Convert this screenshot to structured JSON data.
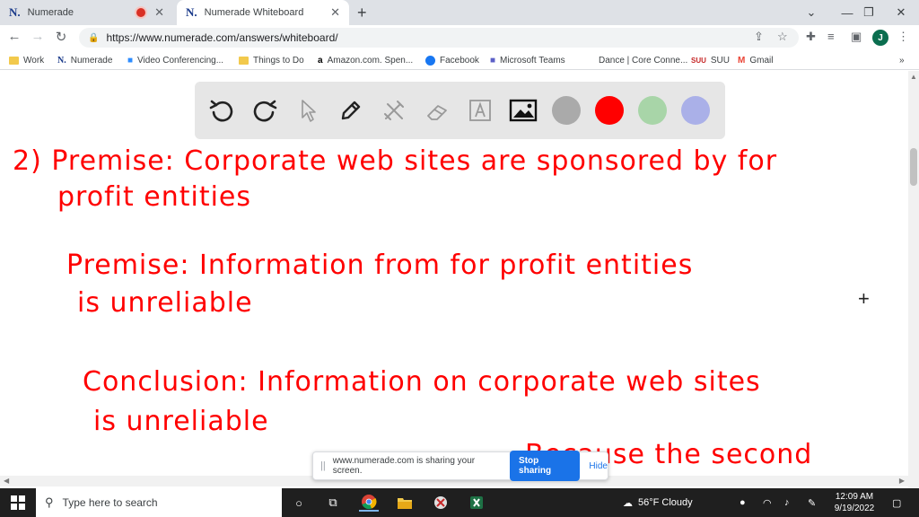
{
  "browser": {
    "tabs": [
      {
        "label": "Numerade",
        "favicon": "N."
      },
      {
        "label": "Numerade Whiteboard",
        "favicon": "N."
      }
    ],
    "new_tab": "+",
    "address": "https://www.numerade.com/answers/whiteboard/",
    "profile_initial": "J",
    "bookmarks": [
      {
        "label": "Work",
        "icon": "folder-icon"
      },
      {
        "label": "Numerade",
        "icon": "N."
      },
      {
        "label": "Video Conferencing...",
        "icon": "video-icon"
      },
      {
        "label": "Things to Do",
        "icon": "folder-icon"
      },
      {
        "label": "Amazon.com. Spen...",
        "icon": "a"
      },
      {
        "label": "Facebook",
        "icon": "facebook-icon"
      },
      {
        "label": "Microsoft Teams",
        "icon": "teams-icon"
      },
      {
        "label": "Dance | Core Conne...",
        "icon": ""
      },
      {
        "label": "SUU",
        "icon": "SUU"
      },
      {
        "label": "Gmail",
        "icon": "M"
      }
    ],
    "bookmarks_more": "»"
  },
  "whiteboard": {
    "colors": [
      "#aaaaaa",
      "#ff0000",
      "#a8d5a8",
      "#aab0e8"
    ],
    "ink_color": "#ff0000",
    "lines": [
      "2) Premise: Corporate web sites are sponsored by for",
      "profit entities",
      "Premise: Information from for profit entities",
      "is unreliable",
      "Conclusion: Information on corporate web sites",
      "is unreliable",
      "Because the second"
    ]
  },
  "share_banner": {
    "grip": "||",
    "message": "www.numerade.com is sharing your screen.",
    "stop_label": "Stop sharing",
    "hide_label": "Hide"
  },
  "taskbar": {
    "search_placeholder": "Type here to search",
    "weather": "56°F  Cloudy",
    "time": "12:09 AM",
    "date": "9/19/2022"
  }
}
